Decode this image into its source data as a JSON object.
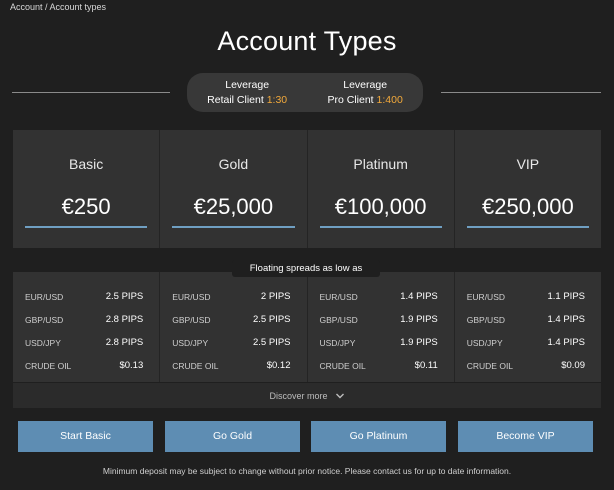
{
  "breadcrumb": "Account / Account types",
  "page_title": "Account Types",
  "leverage": {
    "retail": {
      "heading": "Leverage",
      "label": "Retail Client",
      "value": "1:30"
    },
    "pro": {
      "heading": "Leverage",
      "label": "Pro Client",
      "value": "1:400"
    }
  },
  "plans": [
    {
      "name": "Basic",
      "price": "€250"
    },
    {
      "name": "Gold",
      "price": "€25,000"
    },
    {
      "name": "Platinum",
      "price": "€100,000"
    },
    {
      "name": "VIP",
      "price": "€250,000"
    }
  ],
  "spreads_tag": "Floating spreads as low as",
  "spreads": [
    {
      "rows": [
        {
          "instrument": "EUR/USD",
          "value": "2.5 PIPS"
        },
        {
          "instrument": "GBP/USD",
          "value": "2.8 PIPS"
        },
        {
          "instrument": "USD/JPY",
          "value": "2.8 PIPS"
        },
        {
          "instrument": "CRUDE OIL",
          "value": "$0.13"
        }
      ]
    },
    {
      "rows": [
        {
          "instrument": "EUR/USD",
          "value": "2 PIPS"
        },
        {
          "instrument": "GBP/USD",
          "value": "2.5 PIPS"
        },
        {
          "instrument": "USD/JPY",
          "value": "2.5 PIPS"
        },
        {
          "instrument": "CRUDE OIL",
          "value": "$0.12"
        }
      ]
    },
    {
      "rows": [
        {
          "instrument": "EUR/USD",
          "value": "1.4 PIPS"
        },
        {
          "instrument": "GBP/USD",
          "value": "1.9 PIPS"
        },
        {
          "instrument": "USD/JPY",
          "value": "1.9 PIPS"
        },
        {
          "instrument": "CRUDE OIL",
          "value": "$0.11"
        }
      ]
    },
    {
      "rows": [
        {
          "instrument": "EUR/USD",
          "value": "1.1 PIPS"
        },
        {
          "instrument": "GBP/USD",
          "value": "1.4 PIPS"
        },
        {
          "instrument": "USD/JPY",
          "value": "1.4 PIPS"
        },
        {
          "instrument": "CRUDE OIL",
          "value": "$0.09"
        }
      ]
    }
  ],
  "discover_label": "Discover more",
  "buttons": {
    "start_basic": "Start Basic",
    "go_gold": "Go Gold",
    "go_platinum": "Go Platinum",
    "become_vip": "Become VIP"
  },
  "disclaimer": "Minimum deposit may be subject to change without prior notice. Please contact us for up to date information.",
  "colors": {
    "background": "#1f1f1f",
    "panel": "#323232",
    "accent_orange": "#f2a93b",
    "button_blue": "#5e8db3",
    "underline_blue": "#6f9fc2"
  },
  "icons": {
    "discover": "chevron-down-icon"
  }
}
